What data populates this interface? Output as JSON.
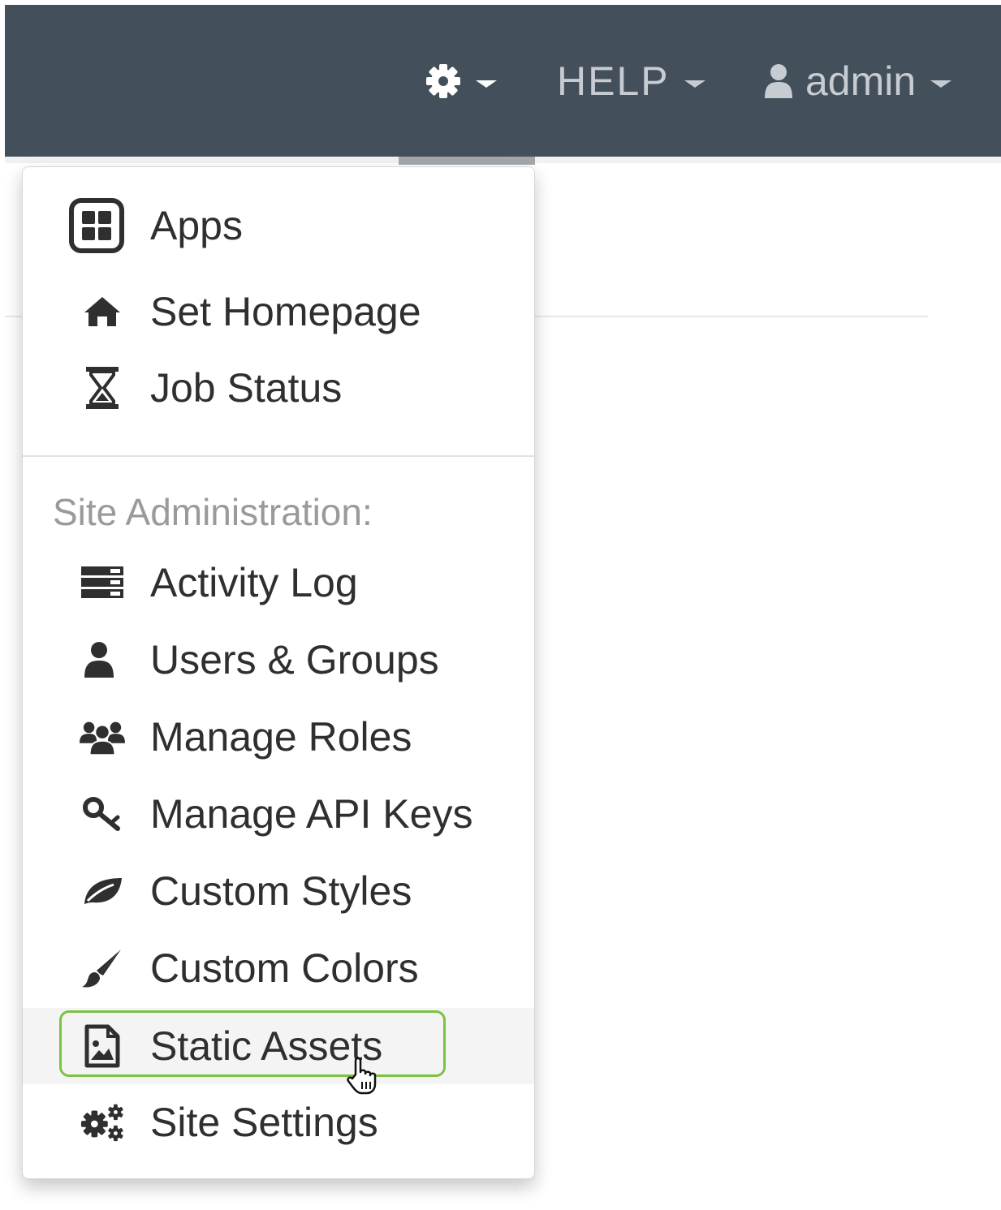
{
  "topbar": {
    "settings_icon": "gear-icon",
    "help_label": "HELP",
    "user_icon": "user-icon",
    "user_label": "admin"
  },
  "dropdown": {
    "items_top": [
      {
        "label": "Apps",
        "icon": "apps-grid-icon"
      },
      {
        "label": "Set Homepage",
        "icon": "home-icon"
      },
      {
        "label": "Job Status",
        "icon": "hourglass-icon"
      }
    ],
    "section_header": "Site Administration:",
    "items_admin": [
      {
        "label": "Activity Log",
        "icon": "server-icon"
      },
      {
        "label": "Users & Groups",
        "icon": "user-icon"
      },
      {
        "label": "Manage Roles",
        "icon": "group-icon"
      },
      {
        "label": "Manage API Keys",
        "icon": "key-icon"
      },
      {
        "label": "Custom Styles",
        "icon": "leaf-icon"
      },
      {
        "label": "Custom Colors",
        "icon": "paintbrush-icon"
      },
      {
        "label": "Static Assets",
        "icon": "image-file-icon",
        "hovered": true
      },
      {
        "label": "Site Settings",
        "icon": "gears-icon"
      }
    ]
  },
  "colors": {
    "topbar_bg": "#434f5a",
    "highlight_border": "#7bc342",
    "hover_bg": "#f4f4f4"
  }
}
